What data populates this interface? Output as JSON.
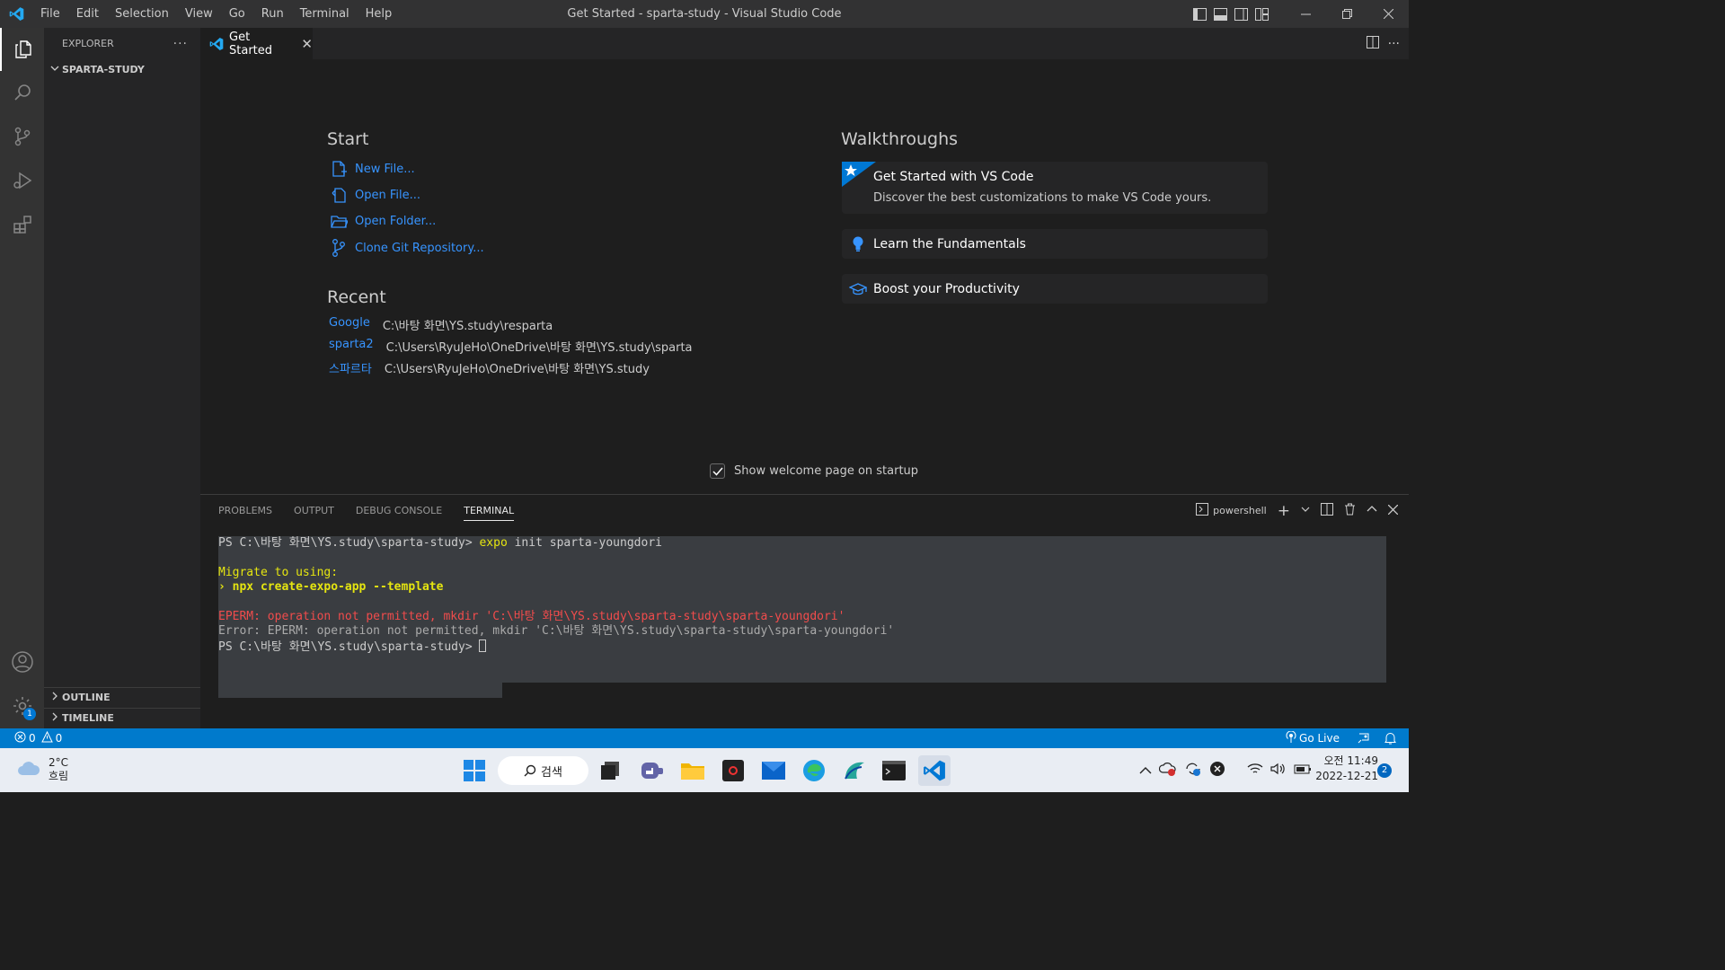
{
  "titlebar": {
    "menu": [
      "File",
      "Edit",
      "Selection",
      "View",
      "Go",
      "Run",
      "Terminal",
      "Help"
    ],
    "window_title": "Get Started - sparta-study - Visual Studio Code"
  },
  "sidebar": {
    "header": "EXPLORER",
    "folder": "SPARTA-STUDY",
    "outline": "OUTLINE",
    "timeline": "TIMELINE",
    "settings_badge": "1"
  },
  "tabs": [
    {
      "label": "Get Started",
      "active": true
    }
  ],
  "welcome": {
    "start_heading": "Start",
    "start_items": [
      "New File...",
      "Open File...",
      "Open Folder...",
      "Clone Git Repository..."
    ],
    "recent_heading": "Recent",
    "recent": [
      {
        "name": "Google",
        "path": "C:\\바탕 화면\\YS.study\\resparta"
      },
      {
        "name": "sparta2",
        "path": "C:\\Users\\RyuJeHo\\OneDrive\\바탕 화면\\YS.study\\sparta"
      },
      {
        "name": "스파르타",
        "path": "C:\\Users\\RyuJeHo\\OneDrive\\바탕 화면\\YS.study"
      }
    ],
    "walkthroughs_heading": "Walkthroughs",
    "walkthroughs": [
      {
        "title": "Get Started with VS Code",
        "description": "Discover the best customizations to make VS Code yours."
      },
      {
        "title": "Learn the Fundamentals"
      },
      {
        "title": "Boost your Productivity"
      }
    ],
    "show_on_startup_label": "Show welcome page on startup",
    "show_on_startup_checked": true
  },
  "panel": {
    "tabs": [
      "PROBLEMS",
      "OUTPUT",
      "DEBUG CONSOLE",
      "TERMINAL"
    ],
    "active_tab": "TERMINAL",
    "terminal_name": "powershell",
    "terminal": {
      "line1_prompt": "PS C:\\바탕 화면\\YS.study\\sparta-study> ",
      "line1_cmd": "expo",
      "line1_args": " init sparta-youngdori",
      "line2": "Migrate to using:",
      "line3": "› npx create-expo-app --template",
      "line4": "EPERM: operation not permitted, mkdir 'C:\\바탕 화면\\YS.study\\sparta-study\\sparta-youngdori'",
      "line5": "Error: EPERM: operation not permitted, mkdir 'C:\\바탕 화면\\YS.study\\sparta-study\\sparta-youngdori'",
      "line6_prompt": "PS C:\\바탕 화면\\YS.study\\sparta-study> "
    }
  },
  "statusbar": {
    "errors": "0",
    "warnings": "0",
    "go_live": "Go Live"
  },
  "taskbar": {
    "weather_temp": "2°C",
    "weather_desc": "흐림",
    "search_label": "검색",
    "time": "오전 11:49",
    "date": "2022-12-21",
    "notifications": "2"
  },
  "colors": {
    "accent": "#007acc",
    "link": "#3794ff",
    "terminal_yellow": "#e5e510",
    "terminal_red": "#f14c4c"
  }
}
